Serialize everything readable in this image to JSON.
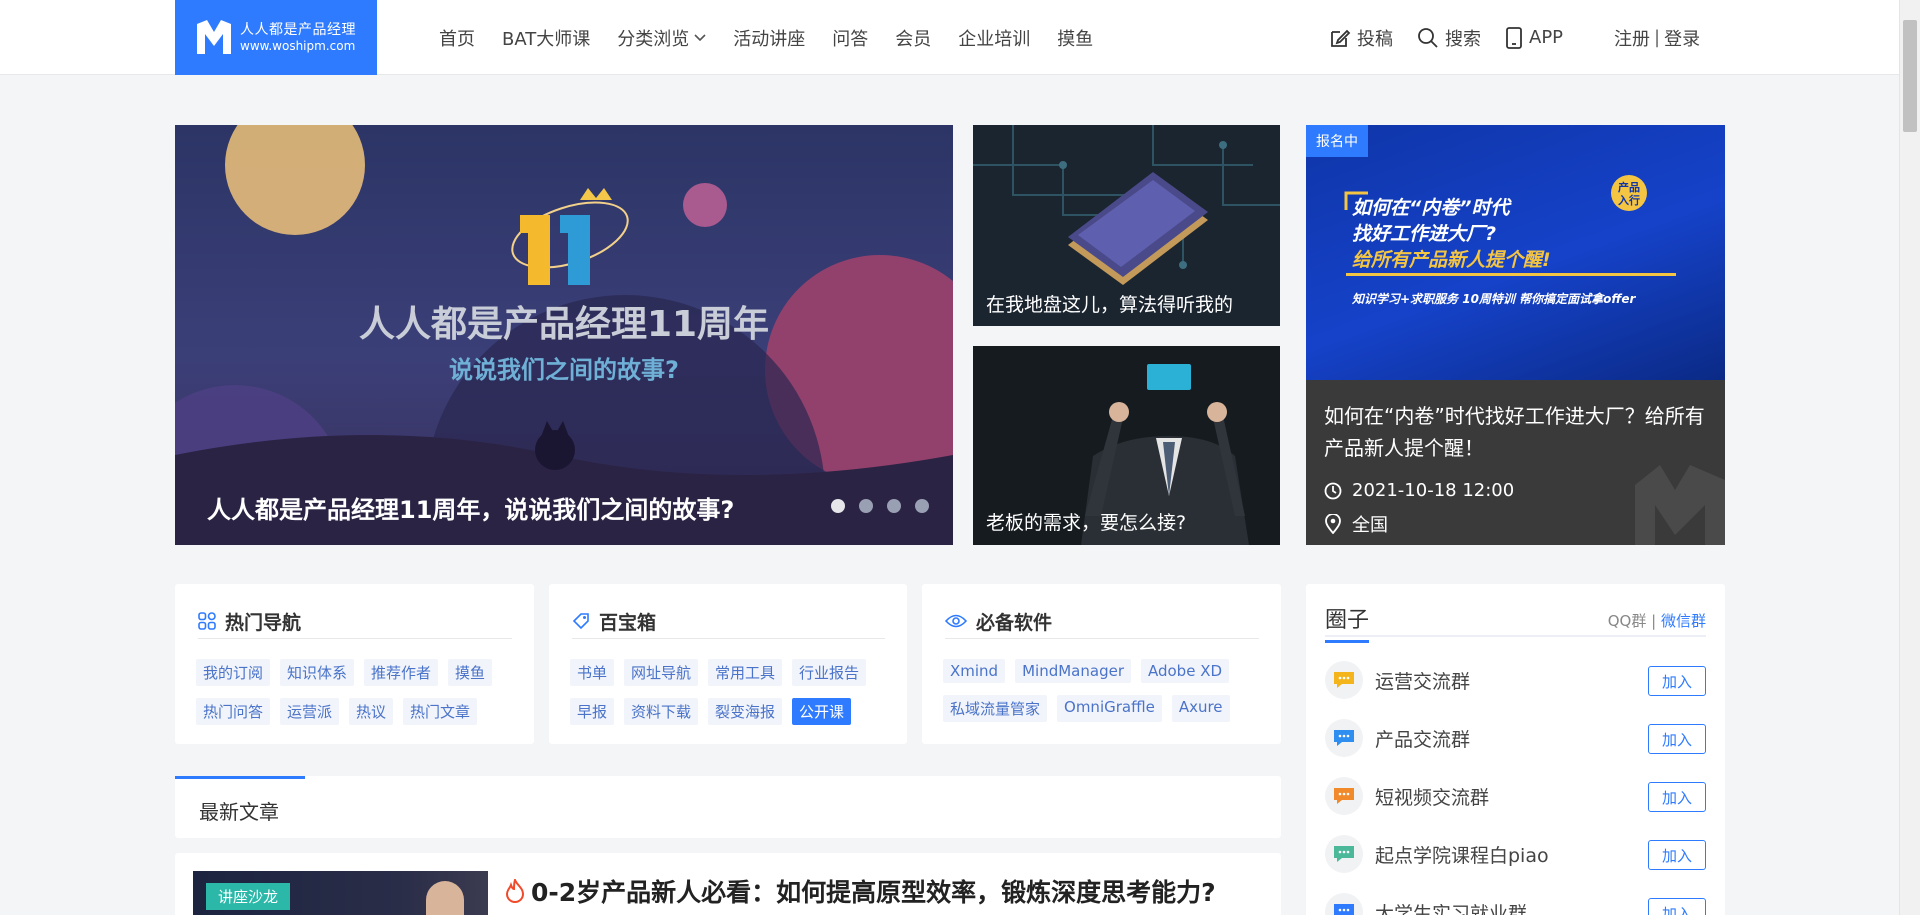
{
  "header": {
    "logo_cn": "人人都是产品经理",
    "logo_url": "www.woshipm.com",
    "nav": [
      "首页",
      "BAT大师课",
      "分类浏览",
      "活动讲座",
      "问答",
      "会员",
      "企业培训",
      "摸鱼"
    ],
    "post_label": "投稿",
    "search_label": "搜索",
    "app_label": "APP",
    "register_label": "注册",
    "auth_sep": "|",
    "login_label": "登录"
  },
  "hero": {
    "main_caption": "人人都是产品经理11周年，说说我们之间的故事?",
    "main_headline": "人人都是产品经理11周年",
    "main_subline": "说说我们之间的故事?",
    "side1_caption": "在我地盘这儿，算法得听我的",
    "side2_caption": "老板的需求，要怎么接?",
    "event": {
      "badge": "报名中",
      "banner_line1": "如何在“内卷”时代",
      "banner_line2": "找好工作进大厂?",
      "banner_line3": "给所有产品新人提个醒!",
      "banner_sub": "知识学习+求职服务 10周特训 帮你搞定面试拿offer",
      "banner_stamp": "产品入行",
      "title": "如何在“内卷”时代找好工作进大厂？给所有产品新人提个醒！",
      "time": "2021-10-18 12:00",
      "location": "全国"
    }
  },
  "cards": {
    "hot_nav": {
      "title": "热门导航",
      "row1": [
        "我的订阅",
        "知识体系",
        "推荐作者",
        "摸鱼"
      ],
      "row2": [
        "热门问答",
        "运营派",
        "热议",
        "热门文章"
      ]
    },
    "toolbox": {
      "title": "百宝箱",
      "row1": [
        "书单",
        "网址导航",
        "常用工具",
        "行业报告"
      ],
      "row2": [
        "早报",
        "资料下载",
        "裂变海报",
        "公开课"
      ]
    },
    "software": {
      "title": "必备软件",
      "row1": [
        "Xmind",
        "MindManager",
        "Adobe XD"
      ],
      "row2": [
        "私域流量管家",
        "OmniGraffle",
        "Axure"
      ]
    }
  },
  "circle": {
    "title": "圈子",
    "qq": "QQ群",
    "sep": "|",
    "wechat": "微信群",
    "groups": [
      {
        "name": "运营交流群",
        "color": "#f3b51b"
      },
      {
        "name": "产品交流群",
        "color": "#2f8ff0"
      },
      {
        "name": "短视频交流群",
        "color": "#f08a2b"
      },
      {
        "name": "起点学院课程白piao",
        "color": "#4cb89a"
      },
      {
        "name": "大学生实习就业群",
        "color": "#2f7bff"
      }
    ],
    "join_label": "加入"
  },
  "latest": {
    "title": "最新文章",
    "article_tag": "讲座沙龙",
    "article_title": "0-2岁产品新人必看：如何提高原型效率，锻炼深度思考能力?"
  },
  "colors": {
    "accent": "#2f7bff",
    "hot": "#f04a2b"
  }
}
